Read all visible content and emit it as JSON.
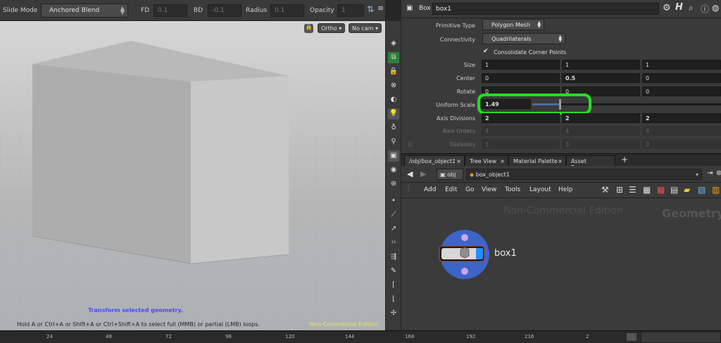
{
  "topbar": {
    "slide_mode_label": "Slide Mode",
    "slide_mode_value": "Anchored Blend",
    "fd_label": "FD",
    "fd_value": "0.1",
    "bd_label": "BD",
    "bd_value": "-0.1",
    "radius_label": "Radius",
    "radius_value": "0.1",
    "opacity_label": "Opacity",
    "opacity_value": "1"
  },
  "viewport": {
    "camera_type": "Ortho",
    "camera_name": "No cam",
    "status_primary": "Transform selected geometry.",
    "status_hint": "Hold A or Ctrl+A or Shift+A or Ctrl+Shift+A to select full (MMB) or partial (LMB) loops.",
    "watermark": "Non-Commercial Edition"
  },
  "param_header": {
    "node_type": "Box",
    "node_name": "box1"
  },
  "params": {
    "primitive_type_label": "Primitive Type",
    "primitive_type_value": "Polygon Mesh",
    "connectivity_label": "Connectivity",
    "connectivity_value": "Quadrilaterals",
    "consolidate_label": "Consolidate Corner Points",
    "size_label": "Size",
    "size_values": [
      "1",
      "1",
      "1"
    ],
    "center_label": "Center",
    "center_values": [
      "0",
      "0.5",
      "0"
    ],
    "rotate_label": "Rotate",
    "rotate_values": [
      "0",
      "0",
      "0"
    ],
    "uniform_scale_label": "Uniform Scale",
    "uniform_scale_value": "1.49",
    "axis_divisions_label": "Axis Divisions",
    "axis_divisions_values": [
      "2",
      "2",
      "2"
    ],
    "axis_orders_label": "Axis Orders",
    "axis_orders_values": [
      "4",
      "4",
      "4"
    ],
    "divisions_label": "Divisions",
    "divisions_values": [
      "3",
      "3",
      "3"
    ]
  },
  "tabs": [
    "/obj/box_object1",
    "Tree View",
    "Material Palette",
    "Asset Browser"
  ],
  "pathbar": {
    "root": "obj",
    "node": "box_object1"
  },
  "menubar": [
    "Add",
    "Edit",
    "Go",
    "View",
    "Tools",
    "Layout",
    "Help"
  ],
  "network": {
    "watermark": "Non-Commercial Edition",
    "context": "Geometry",
    "node_label": "box1"
  },
  "timeline": {
    "ticks": [
      "24",
      "48",
      "72",
      "96",
      "120",
      "144",
      "168",
      "192",
      "216",
      "2"
    ]
  },
  "colors": {
    "highlight": "#22e020",
    "node_ring": "#3d64c8",
    "accent_blue": "#1e90ff"
  }
}
